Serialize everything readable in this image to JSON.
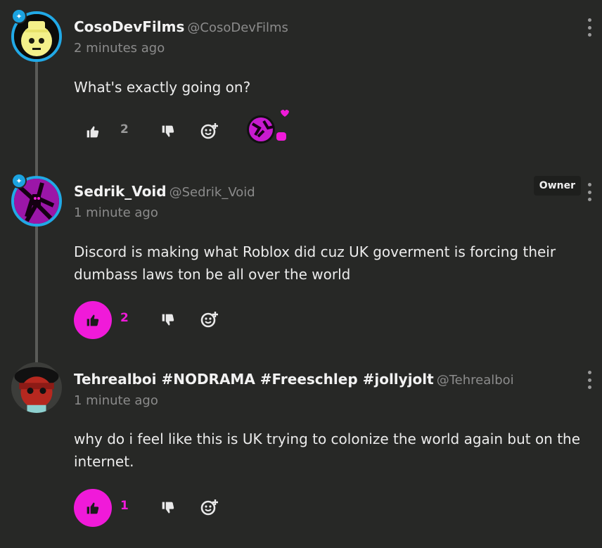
{
  "comments": [
    {
      "username": "CosoDevFilms",
      "handle": "@CosoDevFilms",
      "time": "2 minutes ago",
      "text": "What's exactly going on?",
      "likes": "2",
      "liked": false,
      "owner_badge": "",
      "avatar_icon": "yellow-character-avatar"
    },
    {
      "username": "Sedrik_Void",
      "handle": "@Sedrik_Void",
      "time": "1 minute ago",
      "text": "Discord is making what Roblox did cuz UK goverment is forcing their dumbass laws ton be all over the world",
      "likes": "2",
      "liked": true,
      "owner_badge": "Owner",
      "avatar_icon": "magenta-creature-avatar"
    },
    {
      "username": "Tehrealboi #NODRAMA #Freeschlep #jollyjolt",
      "handle": "@Tehrealboi",
      "time": "1 minute ago",
      "text": "why do i feel like this is UK trying to colonize the world again but on the internet.",
      "likes": "1",
      "liked": true,
      "owner_badge": "",
      "avatar_icon": "red-masked-character-avatar"
    }
  ],
  "colors": {
    "background": "#272826",
    "accent": "#f01ad9",
    "avatar_ring": "#21a9e6",
    "muted": "#8b8b8b"
  },
  "icons": [
    "thumbs-up-icon",
    "thumbs-down-icon",
    "add-reaction-icon",
    "more-options-icon",
    "bird-badge-icon"
  ]
}
